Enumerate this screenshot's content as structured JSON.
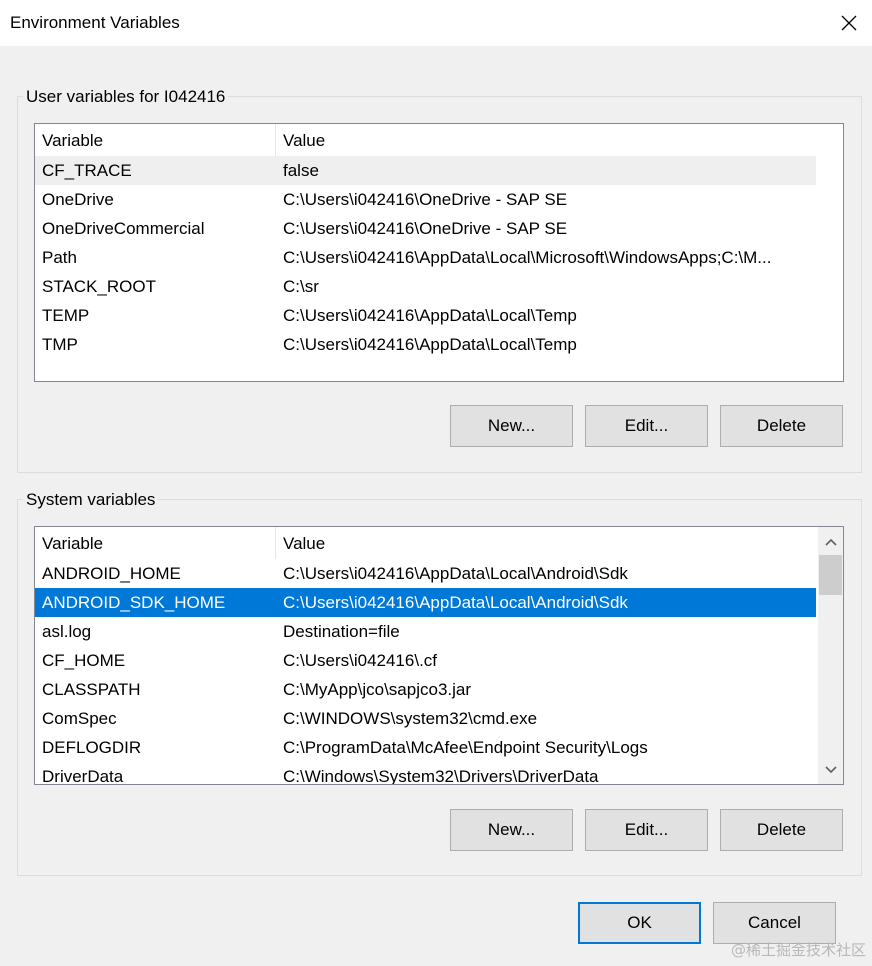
{
  "window": {
    "title": "Environment Variables",
    "close_icon": "close-icon"
  },
  "user_vars": {
    "group_label": "User variables for I042416",
    "columns": [
      "Variable",
      "Value"
    ],
    "rows": [
      {
        "variable": "CF_TRACE",
        "value": "false"
      },
      {
        "variable": "OneDrive",
        "value": "C:\\Users\\i042416\\OneDrive - SAP SE"
      },
      {
        "variable": "OneDriveCommercial",
        "value": "C:\\Users\\i042416\\OneDrive - SAP SE"
      },
      {
        "variable": "Path",
        "value": "C:\\Users\\i042416\\AppData\\Local\\Microsoft\\WindowsApps;C:\\M..."
      },
      {
        "variable": "STACK_ROOT",
        "value": "C:\\sr"
      },
      {
        "variable": "TEMP",
        "value": "C:\\Users\\i042416\\AppData\\Local\\Temp"
      },
      {
        "variable": "TMP",
        "value": "C:\\Users\\i042416\\AppData\\Local\\Temp"
      }
    ],
    "buttons": {
      "new": "New...",
      "edit": "Edit...",
      "delete": "Delete"
    }
  },
  "system_vars": {
    "group_label": "System variables",
    "columns": [
      "Variable",
      "Value"
    ],
    "rows": [
      {
        "variable": "ANDROID_HOME",
        "value": "C:\\Users\\i042416\\AppData\\Local\\Android\\Sdk"
      },
      {
        "variable": "ANDROID_SDK_HOME",
        "value": "C:\\Users\\i042416\\AppData\\Local\\Android\\Sdk"
      },
      {
        "variable": "asl.log",
        "value": "Destination=file"
      },
      {
        "variable": "CF_HOME",
        "value": "C:\\Users\\i042416\\.cf"
      },
      {
        "variable": "CLASSPATH",
        "value": "C:\\MyApp\\jco\\sapjco3.jar"
      },
      {
        "variable": "ComSpec",
        "value": "C:\\WINDOWS\\system32\\cmd.exe"
      },
      {
        "variable": "DEFLOGDIR",
        "value": "C:\\ProgramData\\McAfee\\Endpoint Security\\Logs"
      },
      {
        "variable": "DriverData",
        "value": "C:\\Windows\\System32\\Drivers\\DriverData"
      }
    ],
    "selected_index": 1,
    "buttons": {
      "new": "New...",
      "edit": "Edit...",
      "delete": "Delete"
    }
  },
  "footer": {
    "ok": "OK",
    "cancel": "Cancel"
  },
  "watermark": "@稀土掘金技术社区",
  "colors": {
    "selection": "#0078d7",
    "hover": "#efefef",
    "background": "#f0f0f0"
  }
}
